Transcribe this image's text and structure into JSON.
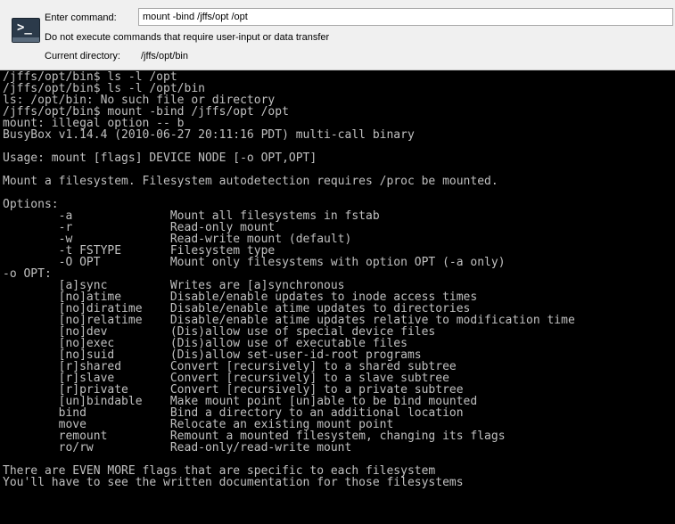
{
  "prompt": {
    "enter_command_label": "Enter command:",
    "command_value": "mount -bind /jffs/opt /opt",
    "no_interactive_note": "Do not execute commands that require user-input or data transfer",
    "current_dir_label": "Current directory:",
    "current_dir_value": "/jffs/opt/bin",
    "icon": "terminal-icon"
  },
  "terminal": {
    "foreground": "#c0c0c0",
    "background": "#000000",
    "lines": [
      "/jffs/opt/bin$ ls -l /opt",
      "/jffs/opt/bin$ ls -l /opt/bin",
      "ls: /opt/bin: No such file or directory",
      "/jffs/opt/bin$ mount -bind /jffs/opt /opt",
      "mount: illegal option -- b",
      "BusyBox v1.14.4 (2010-06-27 20:11:16 PDT) multi-call binary",
      "",
      "Usage: mount [flags] DEVICE NODE [-o OPT,OPT]",
      "",
      "Mount a filesystem. Filesystem autodetection requires /proc be mounted.",
      "",
      "Options:",
      "        -a              Mount all filesystems in fstab",
      "        -r              Read-only mount",
      "        -w              Read-write mount (default)",
      "        -t FSTYPE       Filesystem type",
      "        -O OPT          Mount only filesystems with option OPT (-a only)",
      "-o OPT:",
      "        [a]sync         Writes are [a]synchronous",
      "        [no]atime       Disable/enable updates to inode access times",
      "        [no]diratime    Disable/enable atime updates to directories",
      "        [no]relatime    Disable/enable atime updates relative to modification time",
      "        [no]dev         (Dis)allow use of special device files",
      "        [no]exec        (Dis)allow use of executable files",
      "        [no]suid        (Dis)allow set-user-id-root programs",
      "        [r]shared       Convert [recursively] to a shared subtree",
      "        [r]slave        Convert [recursively] to a slave subtree",
      "        [r]private      Convert [recursively] to a private subtree",
      "        [un]bindable    Make mount point [un]able to be bind mounted",
      "        bind            Bind a directory to an additional location",
      "        move            Relocate an existing mount point",
      "        remount         Remount a mounted filesystem, changing its flags",
      "        ro/rw           Read-only/read-write mount",
      "",
      "There are EVEN MORE flags that are specific to each filesystem",
      "You'll have to see the written documentation for those filesystems"
    ]
  }
}
